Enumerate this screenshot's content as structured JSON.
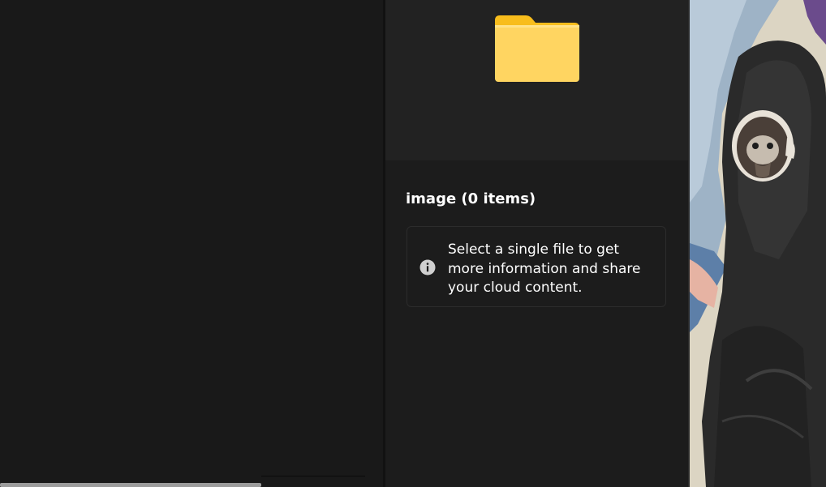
{
  "details_pane": {
    "preview_icon": "folder-icon",
    "title": "image (0 items)",
    "info": {
      "icon": "info-icon",
      "message": "Select a single file to get more information and share your cloud content."
    }
  },
  "colors": {
    "file_pane_bg": "#191919",
    "details_bg": "#1c1c1c",
    "preview_bg": "#222222",
    "folder_yellow": "#ffd561",
    "folder_dark": "#f8bd1c",
    "scrollbar_thumb": "#9c9c9c"
  },
  "wallpaper": {
    "description_icon": "anime-wallpaper-art"
  }
}
